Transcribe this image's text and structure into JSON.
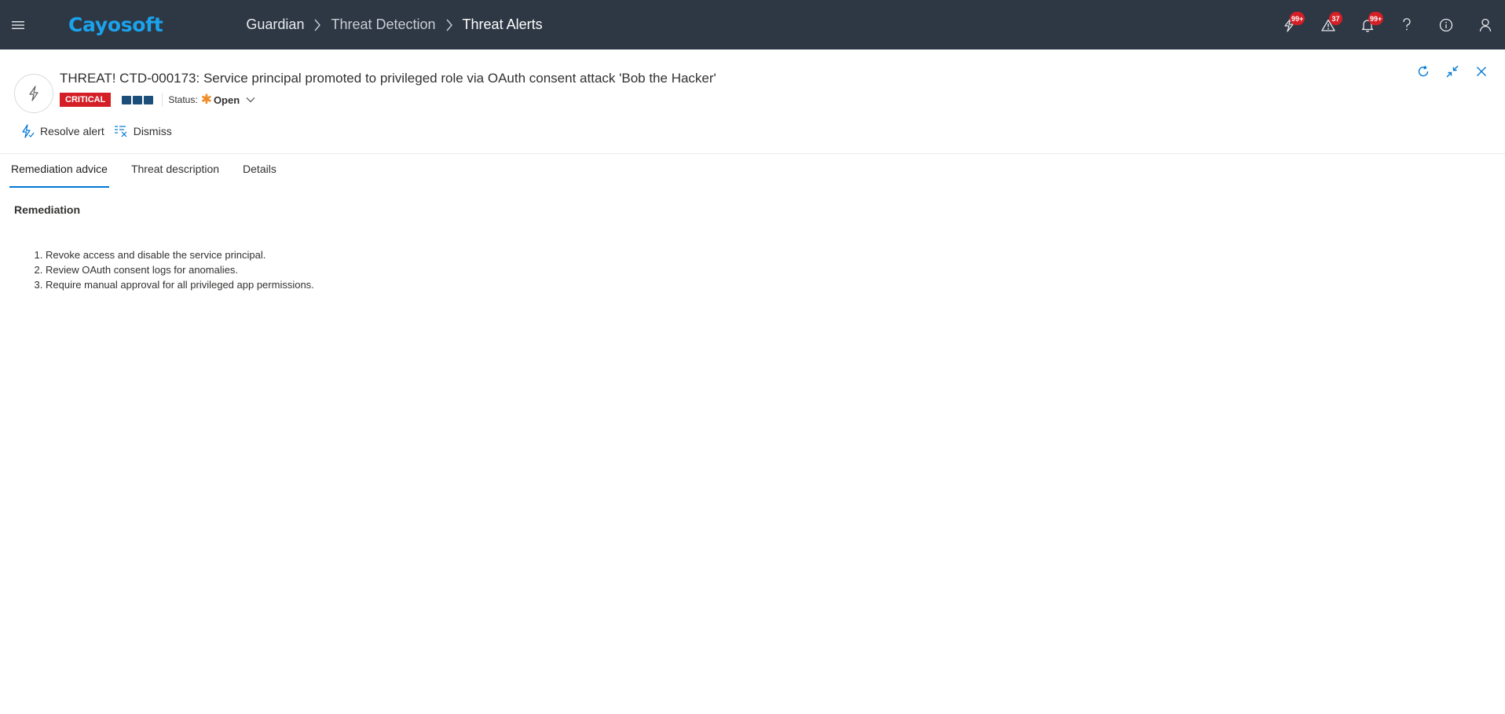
{
  "app": {
    "brand": "Cayosoft"
  },
  "breadcrumb": {
    "items": [
      "Guardian",
      "Threat Detection",
      "Threat Alerts"
    ]
  },
  "top_icons": [
    {
      "name": "threat-detection-icon",
      "badge": "99+"
    },
    {
      "name": "warning-icon",
      "badge": "37"
    },
    {
      "name": "notifications-bell-icon",
      "badge": "99+"
    },
    {
      "name": "help-icon",
      "badge": ""
    },
    {
      "name": "info-icon",
      "badge": ""
    },
    {
      "name": "user-icon",
      "badge": ""
    }
  ],
  "alert": {
    "title": "THREAT! CTD-000173: Service principal promoted to privileged role via OAuth consent attack 'Bob the Hacker'",
    "severity": "CRITICAL",
    "severity_level": 3,
    "status_label": "Status:",
    "status_icon": "✱",
    "status_value": "Open"
  },
  "actions": {
    "resolve": "Resolve alert",
    "dismiss": "Dismiss"
  },
  "tabs": [
    {
      "label": "Remediation advice",
      "active": true
    },
    {
      "label": "Threat description",
      "active": false
    },
    {
      "label": "Details",
      "active": false
    }
  ],
  "remediation": {
    "heading": "Remediation",
    "steps": [
      "Revoke access and disable the service principal.",
      "Review OAuth consent logs for anomalies.",
      "Require manual approval for all privileged app permissions."
    ]
  },
  "colors": {
    "topbar": "#2e3744",
    "brand": "#1aa3ec",
    "critical": "#d41f26",
    "accent": "#0078d4",
    "severity_block": "#1b4f7a",
    "status_open": "#f08a24"
  }
}
